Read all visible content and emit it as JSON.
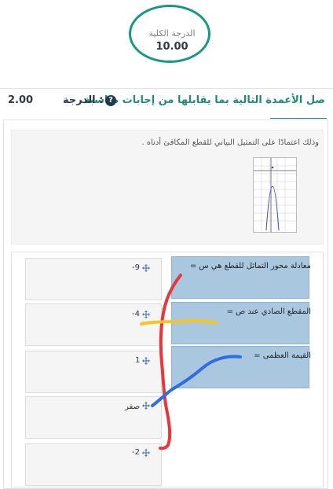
{
  "summary": {
    "total_label": "الدرجة الكلية",
    "total_value": "10.00"
  },
  "question": {
    "title": "صل الأعمدة التالية بما يقابلها من إجابات مناسبة.",
    "help_icon": "question-circle-icon",
    "grade_label": "الدرجة :",
    "grade_value": "2.00",
    "info_text": "وذلك اعتمادًا على التمثيل البياني للقطع المكافئ أدناه ."
  },
  "stems": [
    {
      "text": "معادلة محور التماثل للقطع هي س ="
    },
    {
      "text": "المقطع الصادي عند ص ="
    },
    {
      "text": "القيمة العظمى ="
    }
  ],
  "answers": [
    {
      "label": "-9"
    },
    {
      "label": "-4"
    },
    {
      "label": "1"
    },
    {
      "label": "صفر"
    },
    {
      "label": "-2"
    }
  ],
  "colors": {
    "accent": "#18987f",
    "stem_bg": "#a9c8e0",
    "ink_red": "#e8363b",
    "ink_yellow": "#f3c623",
    "ink_blue": "#2f6de0"
  },
  "icons": {
    "move": "move-arrows-icon"
  }
}
